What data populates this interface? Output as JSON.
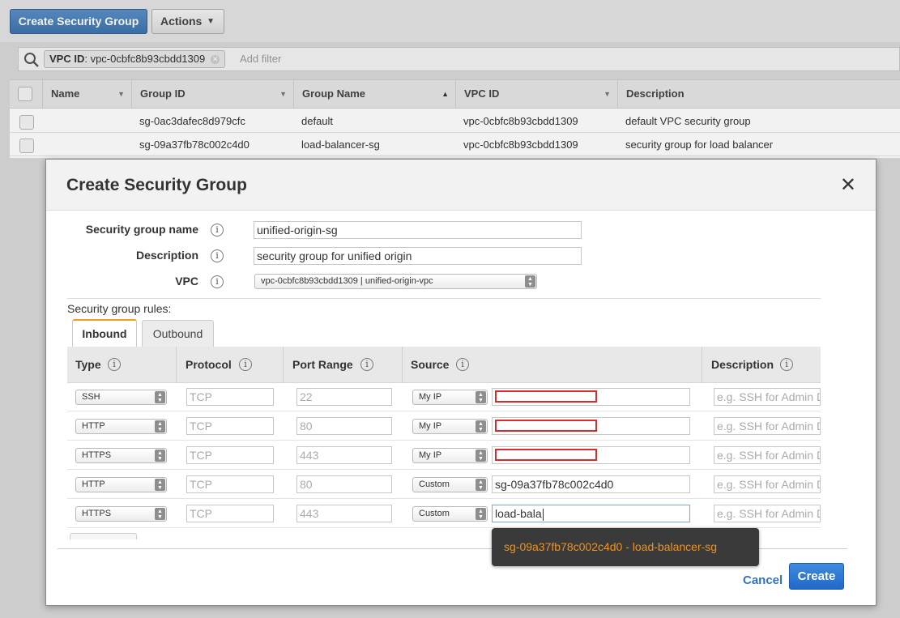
{
  "toolbar": {
    "create_label": "Create Security Group",
    "actions_label": "Actions"
  },
  "filter": {
    "token_key": "VPC ID",
    "token_value": ": vpc-0cbfc8b93cbdd1309",
    "add_placeholder": "Add filter"
  },
  "table": {
    "headers": [
      "Name",
      "Group ID",
      "Group Name",
      "VPC ID",
      "Description"
    ],
    "rows": [
      {
        "name": "",
        "group_id": "sg-0ac3dafec8d979cfc",
        "group_name": "default",
        "vpc_id": "vpc-0cbfc8b93cbdd1309",
        "description": "default VPC security group"
      },
      {
        "name": "",
        "group_id": "sg-09a37fb78c002c4d0",
        "group_name": "load-balancer-sg",
        "vpc_id": "vpc-0cbfc8b93cbdd1309",
        "description": "security group for load balancer"
      }
    ]
  },
  "modal": {
    "title": "Create Security Group",
    "fields": {
      "name_label": "Security group name",
      "name_value": "unified-origin-sg",
      "description_label": "Description",
      "description_value": "security group for unified origin",
      "vpc_label": "VPC",
      "vpc_value": "vpc-0cbfc8b93cbdd1309 | unified-origin-vpc"
    },
    "rules_label": "Security group rules:",
    "tabs": [
      "Inbound",
      "Outbound"
    ],
    "rule_headers": [
      "Type",
      "Protocol",
      "Port Range",
      "Source",
      "Description"
    ],
    "rules": [
      {
        "type": "SSH",
        "protocol": "TCP",
        "port": "22",
        "source_type": "My IP",
        "source_value": "",
        "description_placeholder": "e.g. SSH for Admin D"
      },
      {
        "type": "HTTP",
        "protocol": "TCP",
        "port": "80",
        "source_type": "My IP",
        "source_value": "",
        "description_placeholder": "e.g. SSH for Admin D"
      },
      {
        "type": "HTTPS",
        "protocol": "TCP",
        "port": "443",
        "source_type": "My IP",
        "source_value": "",
        "description_placeholder": "e.g. SSH for Admin D"
      },
      {
        "type": "HTTP",
        "protocol": "TCP",
        "port": "80",
        "source_type": "Custom",
        "source_value": "sg-09a37fb78c002c4d0",
        "description_placeholder": "e.g. SSH for Admin D"
      },
      {
        "type": "HTTPS",
        "protocol": "TCP",
        "port": "443",
        "source_type": "Custom",
        "source_value": "load-bala",
        "description_placeholder": "e.g. SSH for Admin D"
      }
    ],
    "autocomplete": "sg-09a37fb78c002c4d0 - load-balancer-sg",
    "cancel_label": "Cancel",
    "create_label": "Create"
  },
  "colors": {
    "primary": "#2268c8",
    "highlight": "#d92b2b",
    "autocomplete_text": "#f0921f"
  }
}
